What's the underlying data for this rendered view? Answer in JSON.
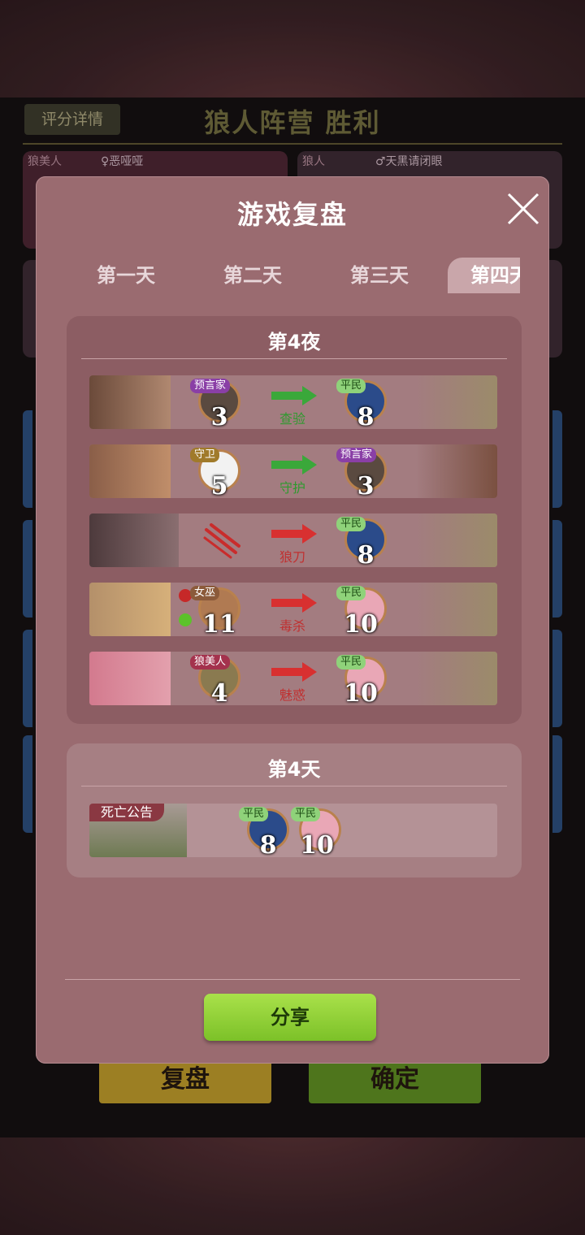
{
  "background": {
    "score_button": "评分详情",
    "result_title": "狼人阵营  胜利",
    "cards": [
      {
        "role": "狼美人",
        "name": "♀恶哑哑"
      },
      {
        "role": "狼人",
        "name": "♂天黑请闭眼"
      }
    ],
    "replay_button": "复盘",
    "confirm_button": "确定"
  },
  "modal": {
    "title": "游戏复盘",
    "tabs": [
      {
        "label": "第一天",
        "active": false
      },
      {
        "label": "第二天",
        "active": false
      },
      {
        "label": "第三天",
        "active": false
      },
      {
        "label": "第四天",
        "active": true
      }
    ],
    "night": {
      "title": "第4夜",
      "actions": [
        {
          "actor_role": "预言家",
          "actor_seat": "3",
          "action": "查验",
          "color": "green",
          "target_role": "平民",
          "target_seat": "8"
        },
        {
          "actor_role": "守卫",
          "actor_seat": "5",
          "action": "守护",
          "color": "green",
          "target_role": "预言家",
          "target_seat": "3"
        },
        {
          "actor_role": "",
          "actor_seat": "",
          "action": "狼刀",
          "color": "red",
          "target_role": "平民",
          "target_seat": "8"
        },
        {
          "actor_role": "女巫",
          "actor_seat": "11",
          "action": "毒杀",
          "color": "red",
          "target_role": "平民",
          "target_seat": "10"
        },
        {
          "actor_role": "狼美人",
          "actor_seat": "4",
          "action": "魅惑",
          "color": "red",
          "target_role": "平民",
          "target_seat": "10"
        }
      ]
    },
    "day": {
      "title": "第4天",
      "death_label": "死亡公告",
      "dead": [
        {
          "role": "平民",
          "seat": "8"
        },
        {
          "role": "平民",
          "seat": "10"
        }
      ]
    },
    "share_button": "分享",
    "colors": {
      "green_arrow": "#3aa83a",
      "red_arrow": "#d83030",
      "accent_green": "#8fd13a"
    }
  }
}
